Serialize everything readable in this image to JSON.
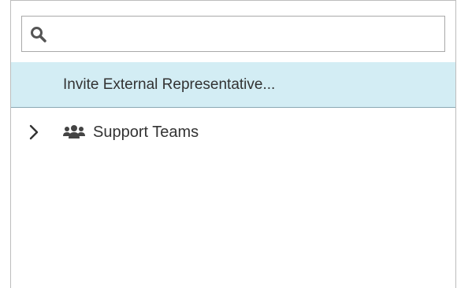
{
  "search": {
    "value": "",
    "placeholder": "",
    "icon": "search-icon"
  },
  "invite": {
    "label": "Invite External Representative..."
  },
  "tree": {
    "items": [
      {
        "label": "Support Teams",
        "expanded": false,
        "icon": "users-group-icon",
        "toggle_icon": "chevron-right-icon"
      }
    ]
  },
  "colors": {
    "selected_bg": "#d3edf4",
    "text": "#333333",
    "border": "#bdbdbd"
  }
}
